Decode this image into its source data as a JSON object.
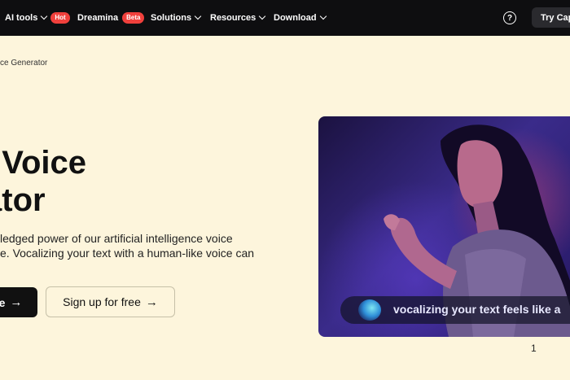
{
  "nav": {
    "items": [
      {
        "label": "AI tools",
        "badge": "Hot"
      },
      {
        "label": "Dreamina",
        "badge": "Beta"
      },
      {
        "label": "Solutions"
      },
      {
        "label": "Resources"
      },
      {
        "label": "Download"
      }
    ],
    "help_icon": "question-circle-icon",
    "try_button": "Try Capt"
  },
  "breadcrumb": "ce Generator",
  "hero": {
    "title_line1": "I Voice",
    "title_line2": "ator",
    "desc_line1": "ledged power of our artificial intelligence voice",
    "desc_line2": "e. Vocalizing your text with a human-like voice can"
  },
  "buttons": {
    "primary_label": "e",
    "secondary_label": "Sign up for free",
    "arrow": "→"
  },
  "media": {
    "caption": "vocalizing your text feels like a"
  },
  "page_number": "1",
  "colors": {
    "background": "#fdf5dc",
    "nav_bg": "#0e0e10",
    "badge_red": "#f0403c"
  }
}
